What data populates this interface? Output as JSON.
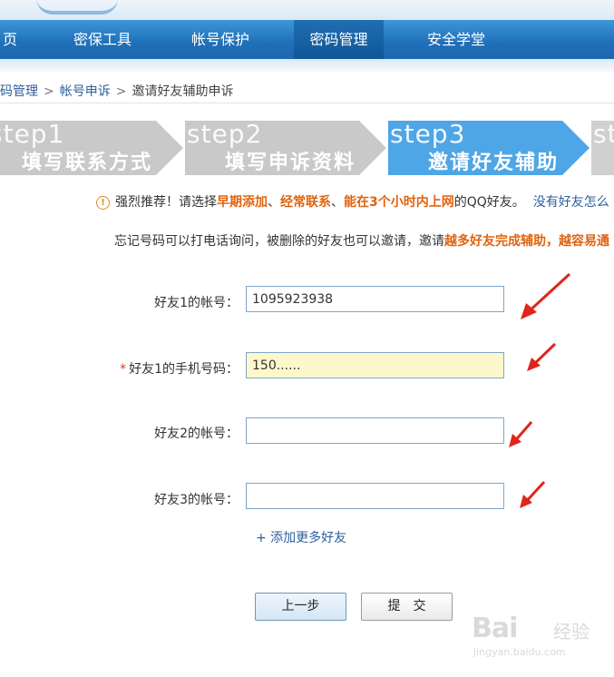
{
  "nav": {
    "items": [
      {
        "label": "页"
      },
      {
        "label": "密保工具"
      },
      {
        "label": "帐号保护"
      },
      {
        "label": "密码管理"
      },
      {
        "label": "安全学堂"
      }
    ]
  },
  "breadcrumb": {
    "first": "码管理",
    "second": "帐号申诉",
    "current": "邀请好友辅助申诉",
    "sep": ">"
  },
  "steps": [
    {
      "num": "step1",
      "caption": "填写联系方式",
      "state": "done"
    },
    {
      "num": "step2",
      "caption": "填写申诉资料",
      "state": "done"
    },
    {
      "num": "step3",
      "caption": "邀请好友辅助",
      "state": "active"
    },
    {
      "num": "ste",
      "caption": "",
      "state": "pending"
    }
  ],
  "colors": {
    "active_step": "#4ea6e6",
    "inactive_step": "#c8c8c8",
    "nav_bg": "#1f6fb8",
    "highlight": "#e0630f",
    "arrow": "#e0251c"
  },
  "notice": {
    "icon": "warning-icon",
    "prefix": "强烈推荐！请选择",
    "h1": "早期添加",
    "sep1": "、",
    "h2": "经常联系",
    "sep2": "、",
    "h3": "能在3个小时内上网",
    "suffix": "的QQ好友。",
    "link": "没有好友怎么"
  },
  "tip": {
    "text": "忘记号码可以打电话询问，被删除的好友也可以邀请，邀请",
    "highlight": "越多好友完成辅助，越容易通"
  },
  "form": {
    "friend1_label": "好友1的帐号：",
    "friend1_value": "1095923938",
    "phone_required": "*",
    "phone_label": "好友1的手机号码：",
    "phone_value": "150......",
    "friend2_label": "好友2的帐号：",
    "friend2_value": "",
    "friend3_label": "好友3的帐号：",
    "friend3_value": "",
    "add_more": "+ 添加更多好友"
  },
  "buttons": {
    "prev": "上一步",
    "submit": "提　交"
  },
  "watermark": {
    "brand": "Bai",
    "sub": "经验",
    "url": "jingyan.baidu.com"
  }
}
